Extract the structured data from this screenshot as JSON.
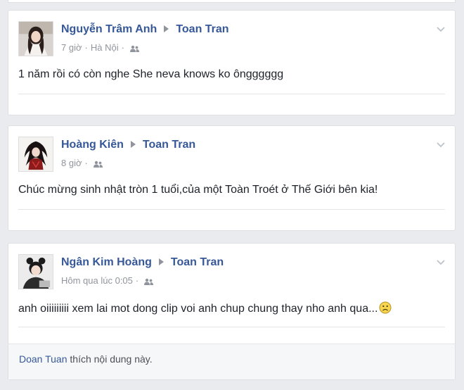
{
  "posts": [
    {
      "author": "Nguyễn Trâm Anh",
      "target": "Toan Tran",
      "time": "7 giờ",
      "location": "Hà Nội",
      "text": "1 năm rồi có còn nghe She neva knows ko ôngggggg"
    },
    {
      "author": "Hoàng Kiên",
      "target": "Toan Tran",
      "time": "8 giờ",
      "text": "Chúc mừng sinh nhật tròn 1 tuổi,của một Toàn Troét ở Thế Giới bên kia!"
    },
    {
      "author": "Ngân Kim Hoàng",
      "target": "Toan Tran",
      "time": "Hôm qua lúc 0:05",
      "text": "anh oiiiiiiiii xem lai mot dong clip voi anh chup chung thay nho anh qua...",
      "emoji": "frown-emoji",
      "likes": {
        "name": "Doan Tuan",
        "suffix": " thích nội dung này."
      }
    }
  ],
  "icons": {
    "audience": "friends-icon",
    "menu": "chevron-down-icon"
  },
  "colors": {
    "link": "#365899",
    "meta": "#90949c",
    "background": "#e9ebee"
  }
}
